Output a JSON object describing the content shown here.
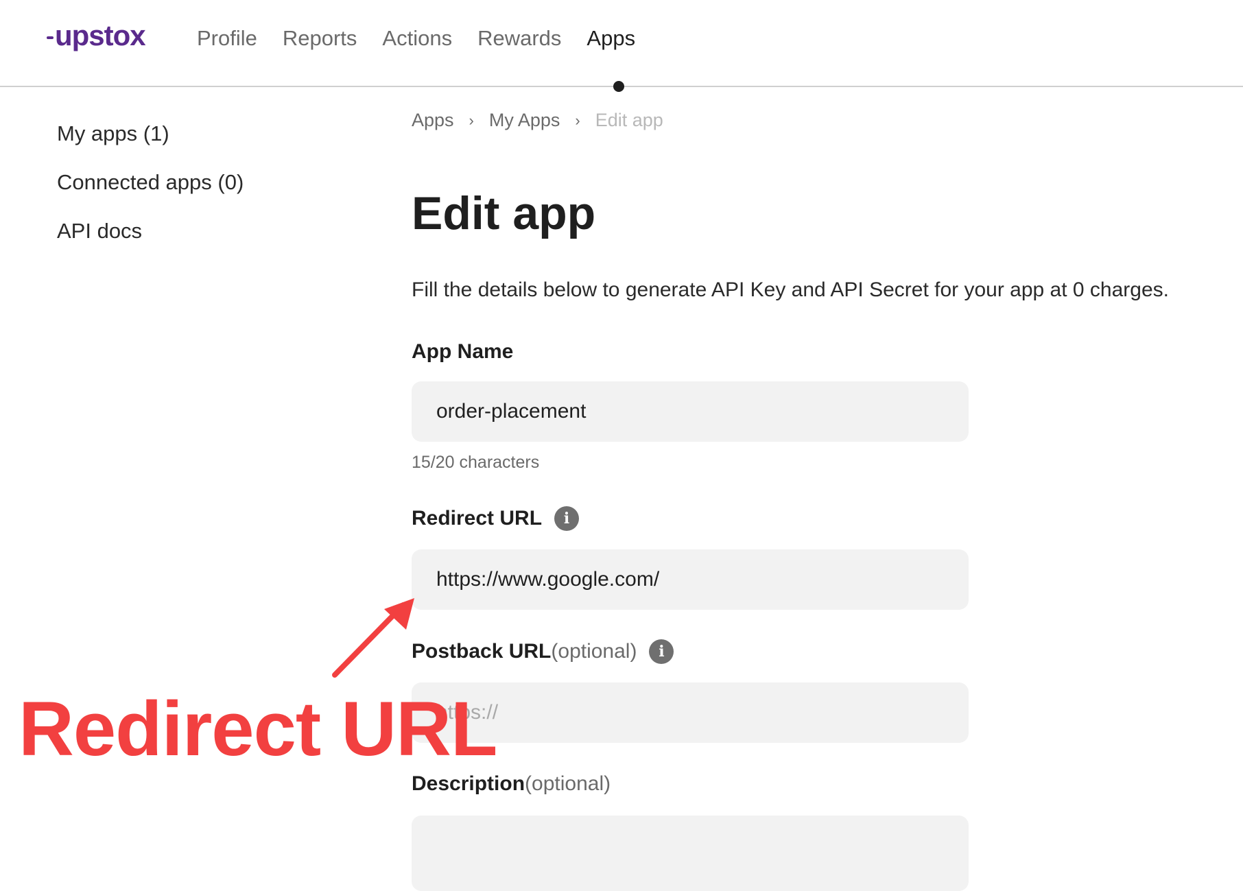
{
  "header": {
    "logo": "upstox",
    "nav": [
      {
        "label": "Profile",
        "active": false
      },
      {
        "label": "Reports",
        "active": false
      },
      {
        "label": "Actions",
        "active": false
      },
      {
        "label": "Rewards",
        "active": false
      },
      {
        "label": "Apps",
        "active": true
      }
    ]
  },
  "sidebar": {
    "items": [
      {
        "label": "My apps (1)"
      },
      {
        "label": "Connected apps (0)"
      },
      {
        "label": "API docs"
      }
    ]
  },
  "breadcrumb": {
    "items": [
      "Apps",
      "My Apps",
      "Edit app"
    ],
    "separator": "›"
  },
  "page": {
    "title": "Edit app",
    "subtitle": "Fill the details below to generate API Key and API Secret for your app at 0 charges."
  },
  "form": {
    "app_name": {
      "label": "App Name",
      "value": "order-placement",
      "char_count": "15/20 characters"
    },
    "redirect_url": {
      "label": "Redirect URL",
      "value": "https://www.google.com/"
    },
    "postback_url": {
      "label": "Postback URL",
      "optional": "(optional)",
      "placeholder": "https://"
    },
    "description": {
      "label": "Description",
      "optional": " (optional)",
      "value": ""
    }
  },
  "annotation": {
    "text": "Redirect URL",
    "color": "#f24040"
  },
  "colors": {
    "brand": "#5a2a8c",
    "input_bg": "#f2f2f2",
    "info_icon": "#6f6f6f"
  }
}
